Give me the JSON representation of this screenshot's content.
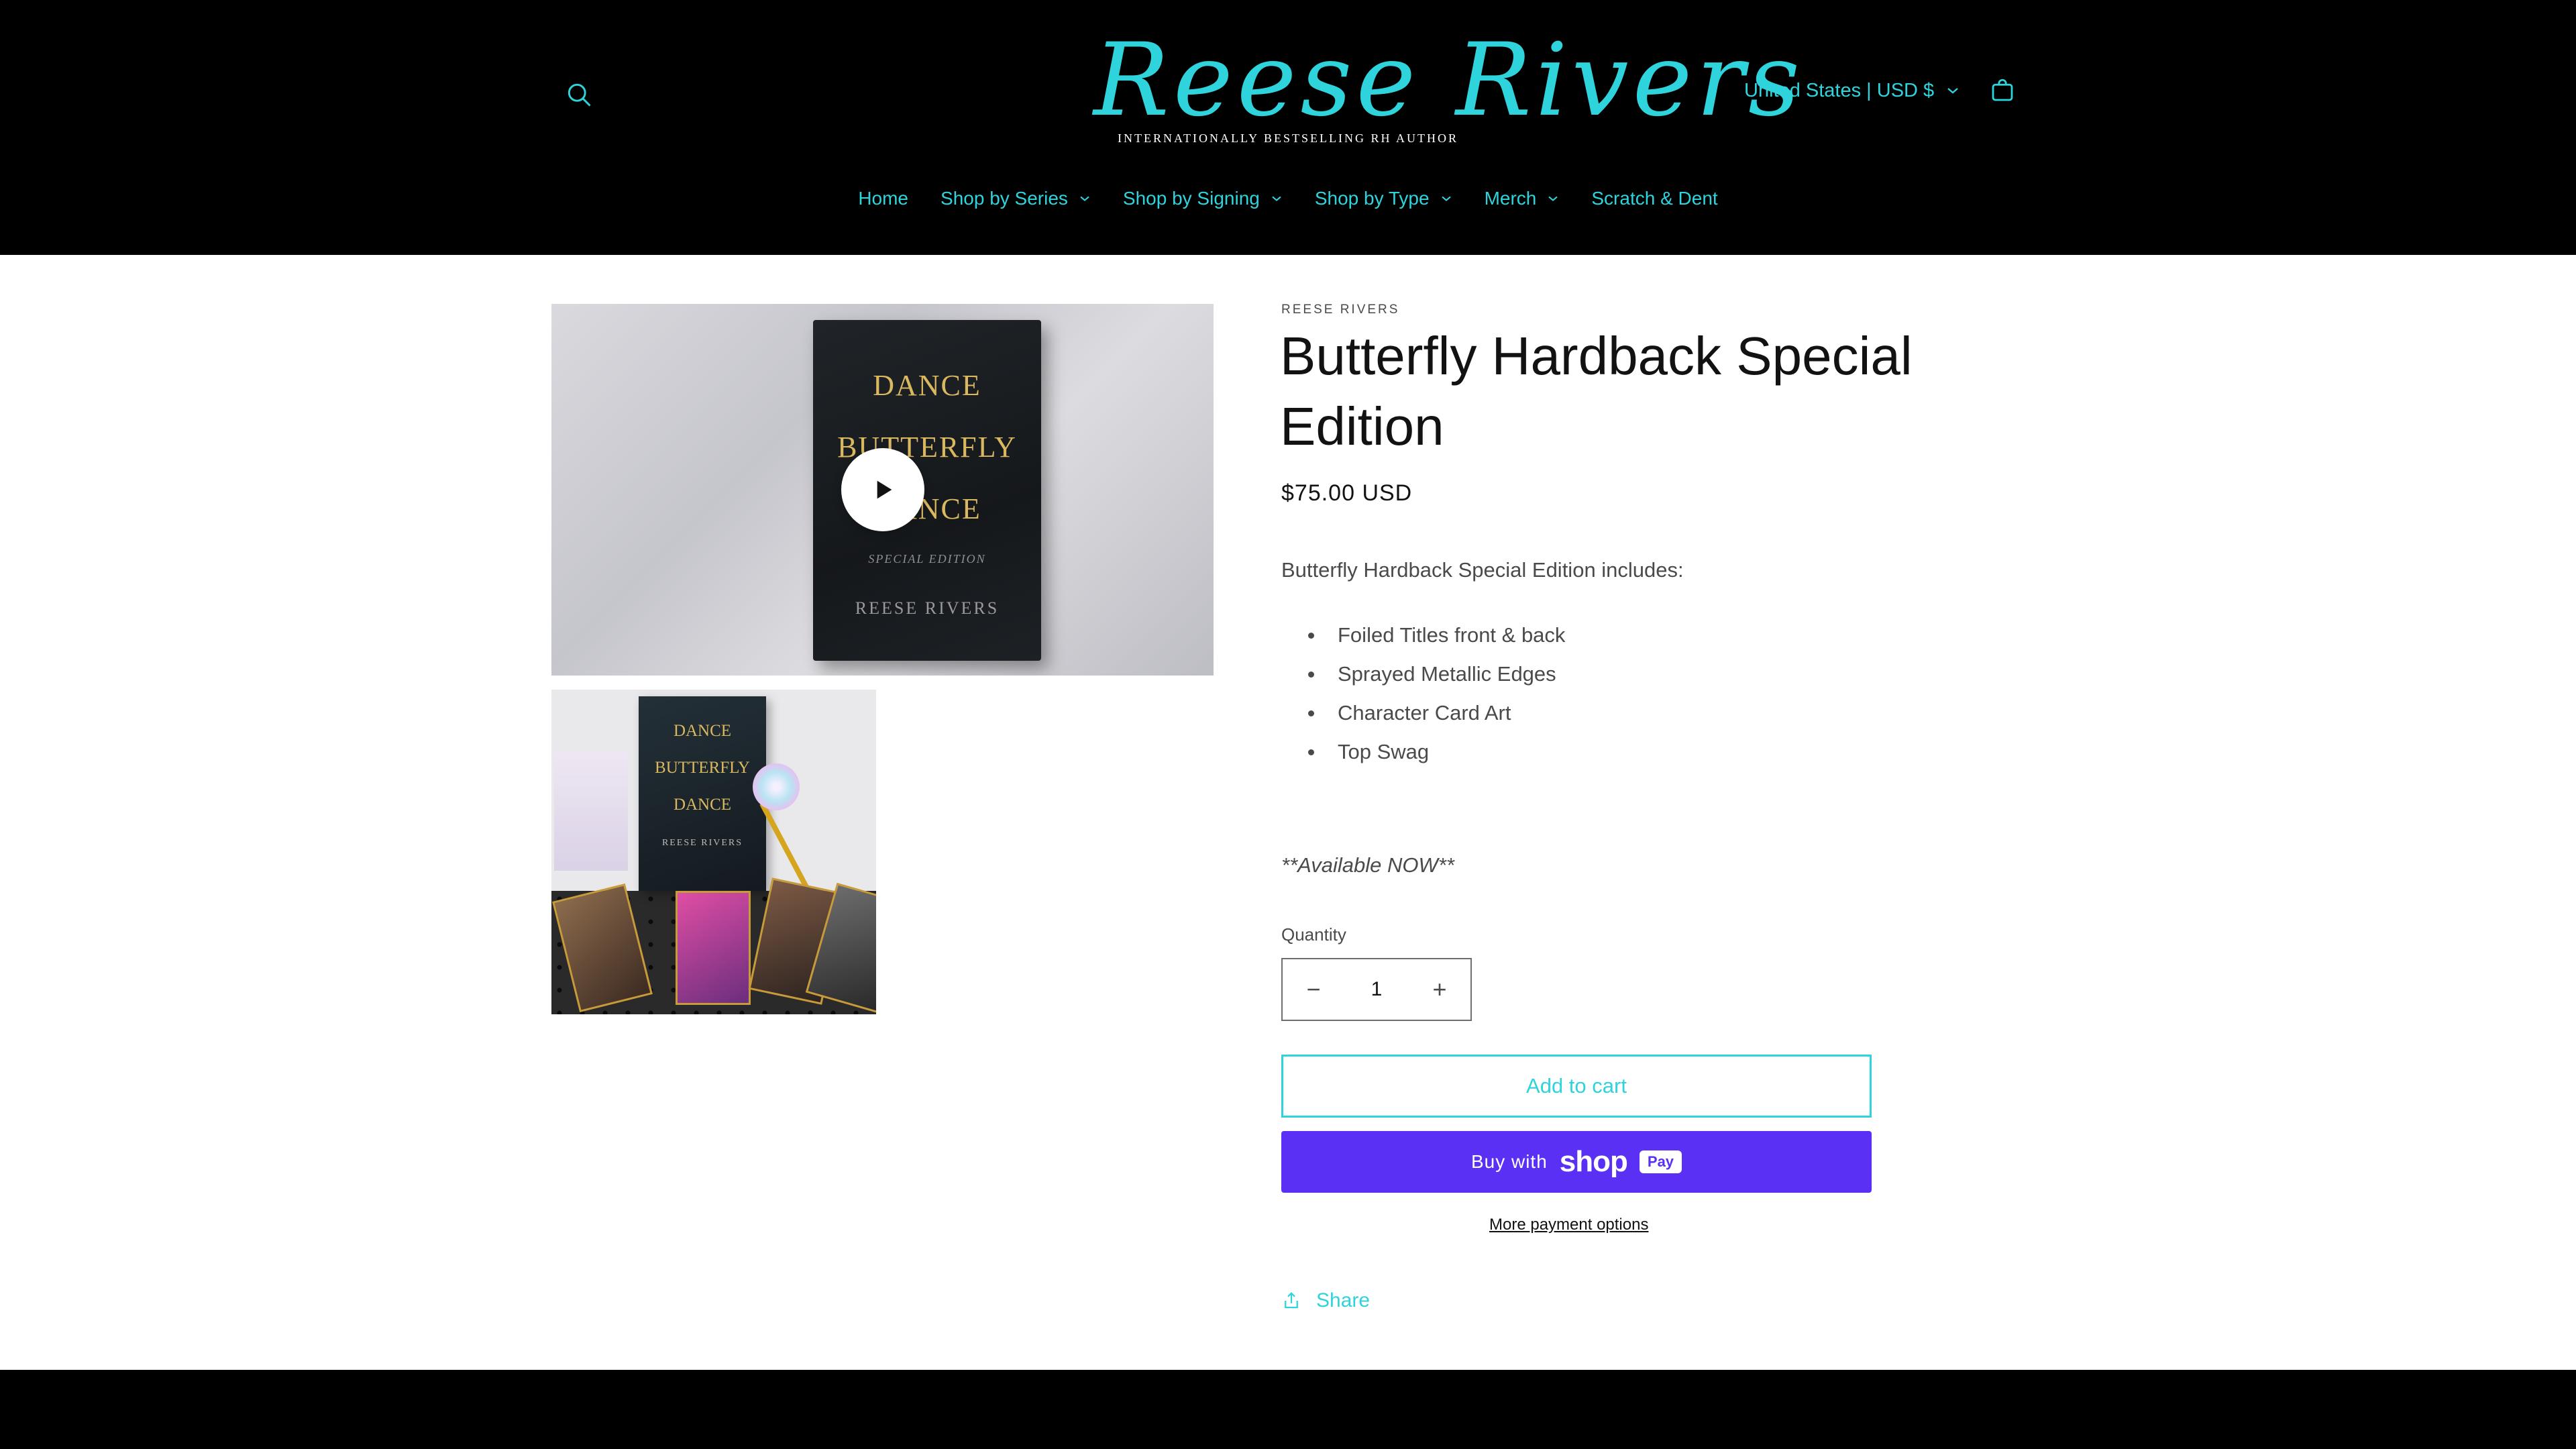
{
  "header": {
    "logo_script": "Reese Rivers",
    "logo_tagline": "INTERNATIONALLY BESTSELLING RH AUTHOR",
    "country_selector": "United States | USD $",
    "accent_color": "#2ed3dc",
    "icons": {
      "search": "search-icon",
      "cart": "cart-icon",
      "dropdown": "chevron-down-icon"
    }
  },
  "nav": {
    "items": [
      {
        "label": "Home",
        "has_dropdown": false
      },
      {
        "label": "Shop by Series",
        "has_dropdown": true
      },
      {
        "label": "Shop by Signing",
        "has_dropdown": true
      },
      {
        "label": "Shop by Type",
        "has_dropdown": true
      },
      {
        "label": "Merch",
        "has_dropdown": true
      },
      {
        "label": "Scratch & Dent",
        "has_dropdown": false
      }
    ]
  },
  "gallery": {
    "main": {
      "type": "video",
      "cover_text": [
        "DANCE",
        "BUTTERFLY",
        "DANCE"
      ],
      "cover_edition": "SPECIAL EDITION",
      "cover_author": "REESE RIVERS",
      "play_icon": "play-icon"
    },
    "thumbnail": {
      "cover_text": [
        "DANCE",
        "BUTTERFLY",
        "DANCE"
      ],
      "cover_author": "REESE RIVERS"
    }
  },
  "product": {
    "vendor": "REESE RIVERS",
    "title": "Butterfly Hardback Special Edition",
    "price": "$75.00 USD",
    "description_intro": "Butterfly Hardback Special Edition includes:",
    "features": [
      "Foiled Titles front & back",
      "Sprayed Metallic Edges",
      "Character Card Art",
      "Top Swag"
    ],
    "availability": "**Available NOW**"
  },
  "purchase": {
    "quantity_label": "Quantity",
    "quantity_value": "1",
    "decrease_symbol": "−",
    "increase_symbol": "+",
    "add_to_cart": "Add to cart",
    "buy_with": "Buy with",
    "shop_word": "shop",
    "pay_word": "Pay",
    "shop_pay_color": "#5a31f4",
    "more_payment": "More payment options",
    "share": "Share"
  }
}
